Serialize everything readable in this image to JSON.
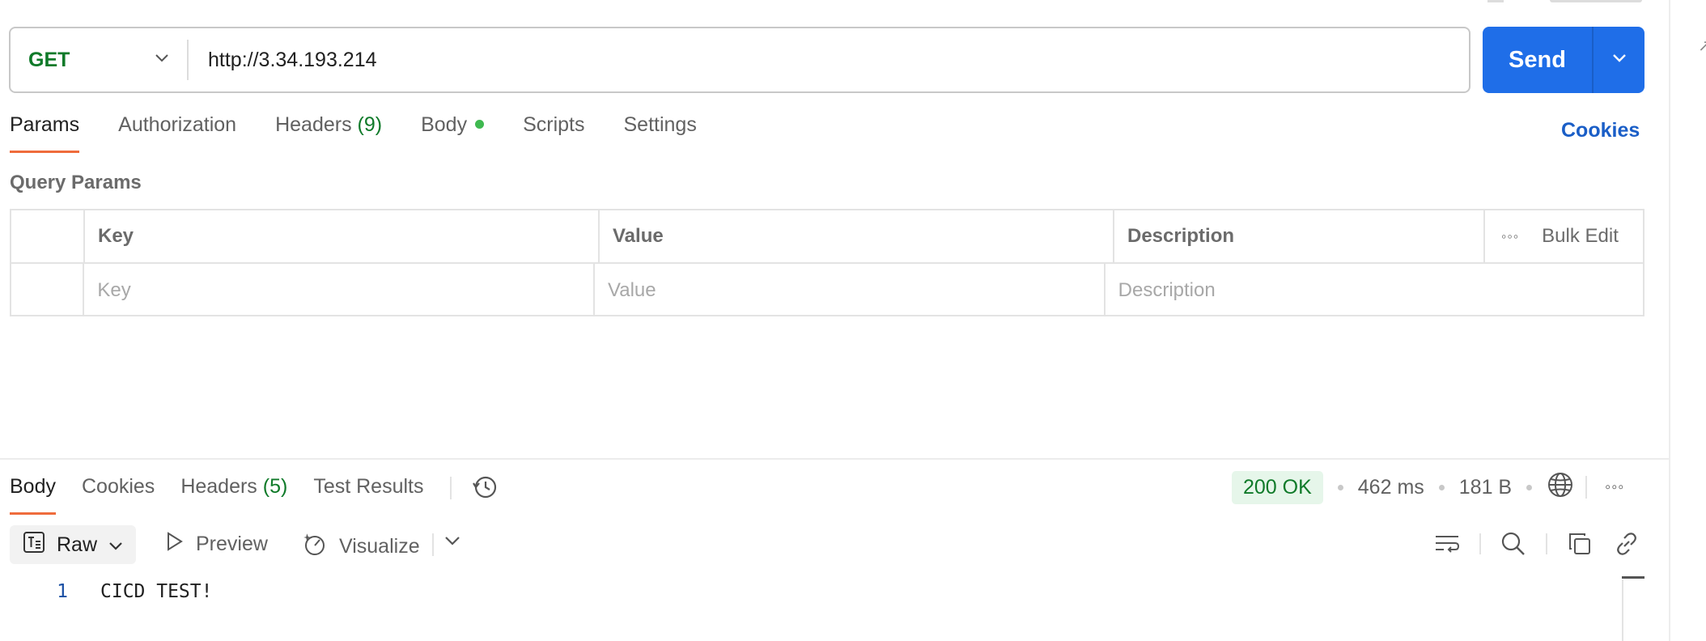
{
  "request": {
    "method": "GET",
    "url": "http://3.34.193.214",
    "send_label": "Send"
  },
  "request_tabs": [
    {
      "label": "Params",
      "active": true
    },
    {
      "label": "Authorization"
    },
    {
      "label": "Headers",
      "count": "(9)"
    },
    {
      "label": "Body",
      "has_dot": true
    },
    {
      "label": "Scripts"
    },
    {
      "label": "Settings"
    }
  ],
  "cookies_link": "Cookies",
  "query_params": {
    "title": "Query Params",
    "columns": [
      "Key",
      "Value",
      "Description"
    ],
    "bulk_edit": "Bulk Edit",
    "placeholders": {
      "key": "Key",
      "value": "Value",
      "description": "Description"
    }
  },
  "response_tabs": [
    {
      "label": "Body",
      "active": true
    },
    {
      "label": "Cookies"
    },
    {
      "label": "Headers",
      "count": "(5)"
    },
    {
      "label": "Test Results"
    }
  ],
  "response_status": {
    "status": "200 OK",
    "time": "462 ms",
    "size": "181 B"
  },
  "response_toolbar": {
    "format": "Raw",
    "preview": "Preview",
    "visualize": "Visualize"
  },
  "response_body": {
    "lines": [
      {
        "no": "1",
        "text": "CICD TEST!"
      }
    ]
  },
  "colors": {
    "method_green": "#0f7a29",
    "send_blue": "#1f6ee8",
    "active_tab_orange": "#ef6c3c",
    "status_green_bg": "#e6f6ea"
  }
}
